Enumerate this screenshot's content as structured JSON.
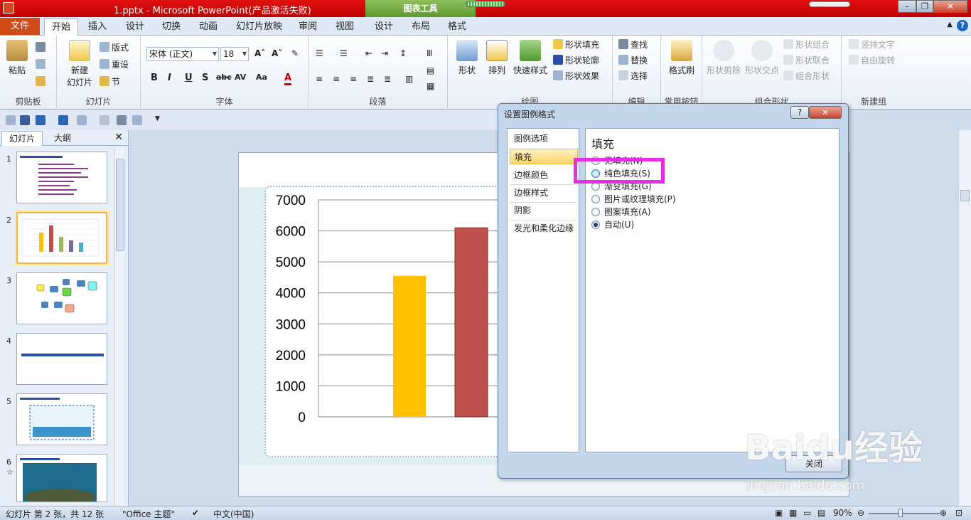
{
  "window": {
    "title": "1.pptx  -  Microsoft PowerPoint(产品激活失败)",
    "context_tab": "图表工具"
  },
  "tabs": [
    "开始",
    "插入",
    "设计",
    "切换",
    "动画",
    "幻灯片放映",
    "审阅",
    "视图",
    "设计",
    "布局",
    "格式"
  ],
  "file_tab": "文件",
  "ribbon": {
    "clipboard": {
      "paste": "粘贴",
      "label": "剪贴板"
    },
    "slides": {
      "new_slide": "新建",
      "new_slide2": "幻灯片",
      "layout": "版式",
      "reset": "重设",
      "section": "节",
      "label": "幻灯片"
    },
    "font": {
      "font_name": "宋体 (正文)",
      "font_size": "18",
      "label": "字体"
    },
    "paragraph": {
      "label": "段落"
    },
    "drawing": {
      "shapes": "形状",
      "arrange": "排列",
      "quick_styles": "快速样式",
      "shape_fill": "形状填充",
      "shape_outline": "形状轮廓",
      "shape_effects": "形状效果",
      "label": "绘图"
    },
    "editing": {
      "find": "查找",
      "replace": "替换",
      "select": "选择",
      "label": "编辑"
    },
    "common": {
      "format_painter": "格式刷",
      "label": "常用按钮"
    },
    "combine": {
      "shape_subtract": "形状剪除",
      "shape_intersect": "形状交点",
      "shape_combine": "形状组合",
      "shape_union": "形状联合",
      "group_shape": "组合形状",
      "label": "组合形状"
    },
    "newgroup": {
      "vertical_text": "竖排文字",
      "free_rotate": "自由旋转",
      "label": "新建组"
    }
  },
  "left_panel": {
    "tab_slides": "幻灯片",
    "tab_outline": "大纲",
    "close": "✕",
    "thumbs": [
      "1",
      "2",
      "3",
      "4",
      "5",
      "6"
    ]
  },
  "chart_data": {
    "type": "bar",
    "categories": [
      "",
      ""
    ],
    "series": [
      {
        "values": [
          4550
        ],
        "color": "#ffc000"
      },
      {
        "values": [
          6100
        ],
        "color": "#c0504d"
      }
    ],
    "yticks": [
      "7000",
      "6000",
      "5000",
      "4000",
      "3000",
      "2000",
      "1000",
      "0"
    ],
    "ylim": [
      0,
      7000
    ],
    "grid": true
  },
  "dialog": {
    "title": "设置图例格式",
    "help": "?",
    "close_x": "✕",
    "nav": [
      "图例选项",
      "填充",
      "边框颜色",
      "边框样式",
      "阴影",
      "发光和柔化边缘"
    ],
    "selected_nav": "填充",
    "section_title": "填充",
    "options": [
      "无填充(N)",
      "纯色填充(S)",
      "渐变填充(G)",
      "图片或纹理填充(P)",
      "图案填充(A)",
      "自动(U)"
    ],
    "selected_option": "自动(U)",
    "close_button": "关闭"
  },
  "statusbar": {
    "slide_info": "幻灯片 第 2 张，共 12 张",
    "theme": "\"Office 主题\"",
    "language": "中文(中国)",
    "zoom": "90%"
  },
  "watermark": {
    "brand": "Baidu经验",
    "url": "jingyan.baidu.com"
  }
}
